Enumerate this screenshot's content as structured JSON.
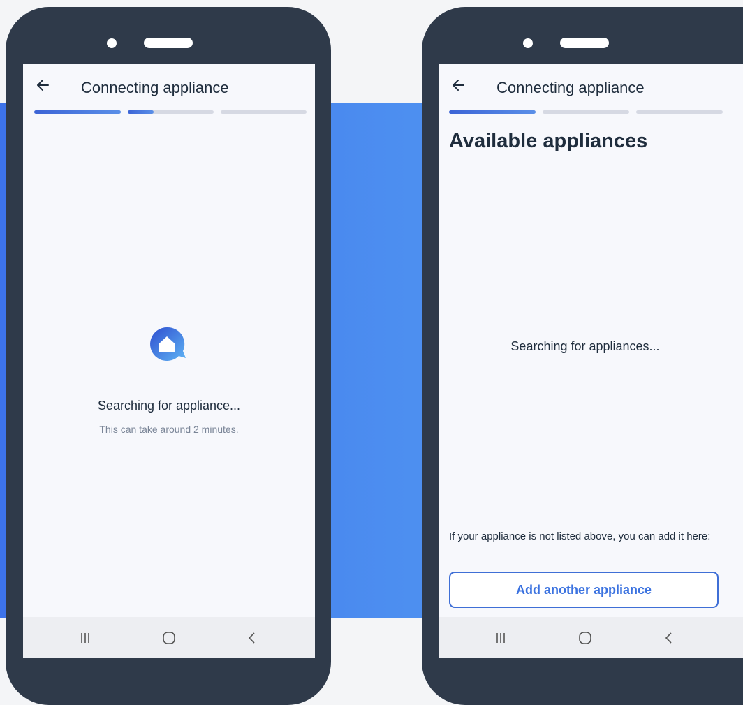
{
  "left_screen": {
    "title": "Connecting appliance",
    "progress_steps": [
      1,
      0.3,
      0
    ],
    "icon": "home-chat-icon",
    "status": "Searching for appliance...",
    "hint": "This can take around 2 minutes."
  },
  "right_screen": {
    "title": "Connecting appliance",
    "progress_steps": [
      1,
      0,
      0
    ],
    "heading": "Available appliances",
    "status": "Searching for appliances...",
    "note": "If your appliance is not listed above, you can add it here:",
    "add_button": "Add another appliance"
  },
  "navbar": {
    "icons": [
      "recent-apps-icon",
      "home-icon",
      "back-icon"
    ]
  },
  "colors": {
    "frame": "#2f3a4a",
    "accent": "#3c73e0",
    "background_band": "#4d8ff0",
    "text": "#1f2d3d"
  }
}
